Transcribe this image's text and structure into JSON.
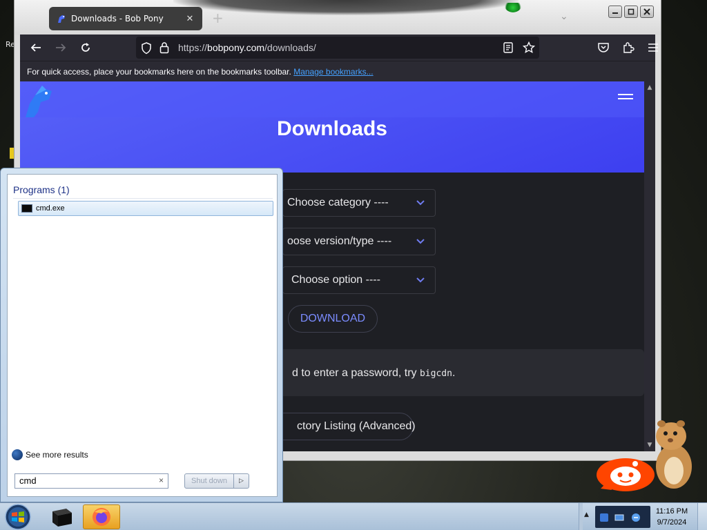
{
  "desktop": {
    "edge_text": "Re"
  },
  "browser": {
    "tab_title": "Downloads - Bob Pony",
    "tab_close": "✕",
    "new_tab": "+",
    "url_scheme": "https://",
    "url_host": "bobpony.com",
    "url_path": "/downloads/",
    "bookmarks_message": "For quick access, place your bookmarks here on the bookmarks toolbar.",
    "bookmarks_link": "Manage bookmarks..."
  },
  "page": {
    "title": "Downloads",
    "select_category": "Choose category ----",
    "select_version": "oose version/type ----",
    "select_option": "Choose option ----",
    "download_button": "DOWNLOAD",
    "password_note": "d to enter a password, try ",
    "password_code": "bigcdn",
    "password_end": ".",
    "directory_button": "ctory Listing (Advanced)"
  },
  "start_menu": {
    "group_header": "Programs (1)",
    "result_item": "cmd.exe",
    "see_more": "See more results",
    "search_value": "cmd",
    "search_clear": "×",
    "shutdown_label": "Shut down",
    "shutdown_arrow": "▷"
  },
  "taskbar": {
    "clock_time": "11:16 PM",
    "clock_date": "9/7/2024",
    "tray_expand": "▲"
  },
  "colors": {
    "hero_blue": "#3d3ff0",
    "page_bg": "#1e1f24",
    "link": "#45a1ff",
    "accent_text": "#7b8cff"
  }
}
